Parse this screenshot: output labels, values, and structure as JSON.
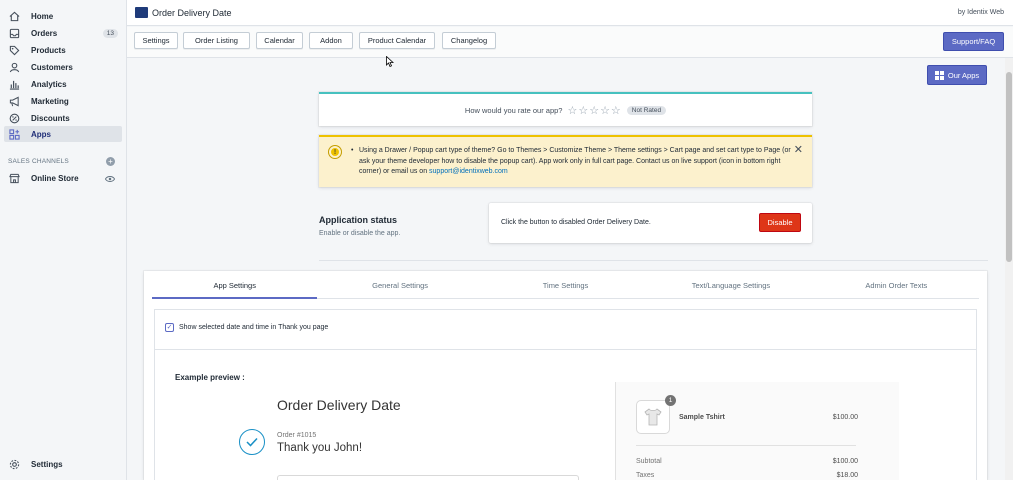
{
  "sidebar": {
    "items": [
      {
        "label": "Home",
        "icon": "home-icon"
      },
      {
        "label": "Orders",
        "icon": "orders-icon",
        "badge": "13"
      },
      {
        "label": "Products",
        "icon": "tag-icon"
      },
      {
        "label": "Customers",
        "icon": "person-icon"
      },
      {
        "label": "Analytics",
        "icon": "bar-chart-icon"
      },
      {
        "label": "Marketing",
        "icon": "megaphone-icon"
      },
      {
        "label": "Discounts",
        "icon": "discount-icon"
      },
      {
        "label": "Apps",
        "icon": "apps-icon",
        "active": true
      }
    ],
    "sales_channels_label": "SALES CHANNELS",
    "online_store": "Online Store",
    "settings": "Settings"
  },
  "topbar": {
    "app_title": "Order Delivery Date",
    "by": "by Identix Web"
  },
  "toolbar": {
    "buttons": [
      "Settings",
      "Order Listing",
      "Calendar",
      "Addon",
      "Product Calendar",
      "Changelog"
    ],
    "support": "Support/FAQ"
  },
  "our_apps": "Our Apps",
  "rating": {
    "question": "How would you rate our app?",
    "stars": "☆☆☆☆☆",
    "status": "Not Rated"
  },
  "warning": {
    "text": "Using a Drawer / Popup cart type of theme? Go to Themes > Customize Theme > Theme settings > Cart page and set cart type to Page (or ask your theme developer how to disable the popup cart). App work only in full cart page. Contact us on live support (icon in bottom right corner) or email us on ",
    "email": "support@identixweb.com"
  },
  "app_status": {
    "title": "Application status",
    "subtitle": "Enable or disable the app.",
    "message": "Click the button to disabled Order Delivery Date.",
    "button": "Disable"
  },
  "tabs": [
    "App Settings",
    "General Settings",
    "Time Settings",
    "Text/Language Settings",
    "Admin Order Texts"
  ],
  "settings": {
    "checkbox_label": "Show selected date and time in Thank you page",
    "example_label": "Example preview :"
  },
  "preview": {
    "title": "Order Delivery Date",
    "order_number": "Order #1015",
    "thanks": "Thank you John!",
    "product_name": "Sample Tshirt",
    "product_price": "$100.00",
    "quantity": "1",
    "subtotal_label": "Subtotal",
    "subtotal_value": "$100.00",
    "taxes_label": "Taxes",
    "taxes_value": "$18.00"
  }
}
